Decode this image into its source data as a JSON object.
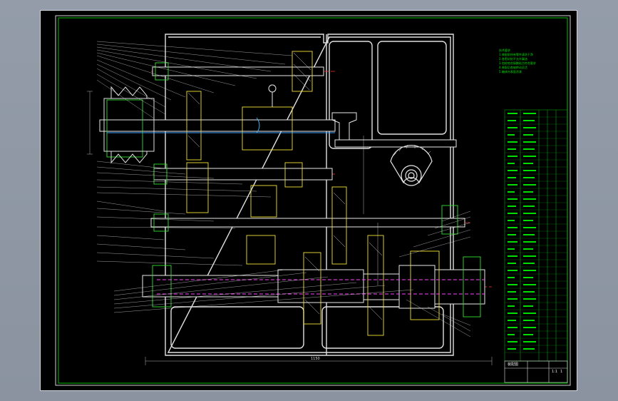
{
  "drawing": {
    "title_block": {
      "label": "装配图",
      "scale": "1:1",
      "sheet": "1"
    },
    "notes": {
      "heading": "技术要求",
      "lines": [
        "1.装配前所有零件清洗干净",
        "2.各密封处不允许漏油",
        "3.齿轮啮合接触斑点符合要求",
        "4.装配后各轴转动灵活",
        "5.箱体外表面涂漆"
      ]
    },
    "dimension_label": "1150"
  }
}
